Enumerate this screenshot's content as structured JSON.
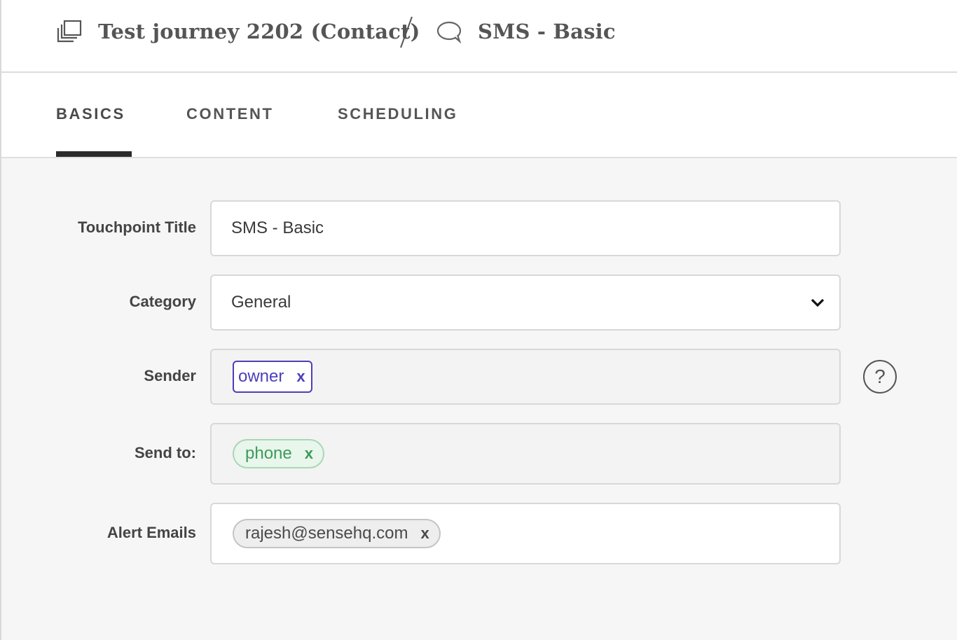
{
  "breadcrumb": {
    "journey_title": "Test journey 2202 (Contact)",
    "journey_icon": "journey-stack-icon",
    "separator": "/",
    "step_title": "SMS - Basic",
    "step_icon": "chat-bubble-icon"
  },
  "tabs": [
    {
      "label": "BASICS",
      "active": true
    },
    {
      "label": "CONTENT",
      "active": false
    },
    {
      "label": "SCHEDULING",
      "active": false
    }
  ],
  "form": {
    "title": {
      "label": "Touchpoint Title",
      "value": "SMS - Basic"
    },
    "category": {
      "label": "Category",
      "value": "General"
    },
    "sender": {
      "label": "Sender",
      "chip": "owner",
      "remove": "x",
      "help": "?"
    },
    "send_to": {
      "label": "Send to:",
      "chip": "phone",
      "remove": "x"
    },
    "alert_emails": {
      "label": "Alert Emails",
      "chip": "rajesh@sensehq.com",
      "remove": "x"
    }
  },
  "colors": {
    "owner_chip": "#4d3fb8",
    "phone_chip": "#3f9a5a",
    "tab_active_underline": "#2b2b2b"
  }
}
